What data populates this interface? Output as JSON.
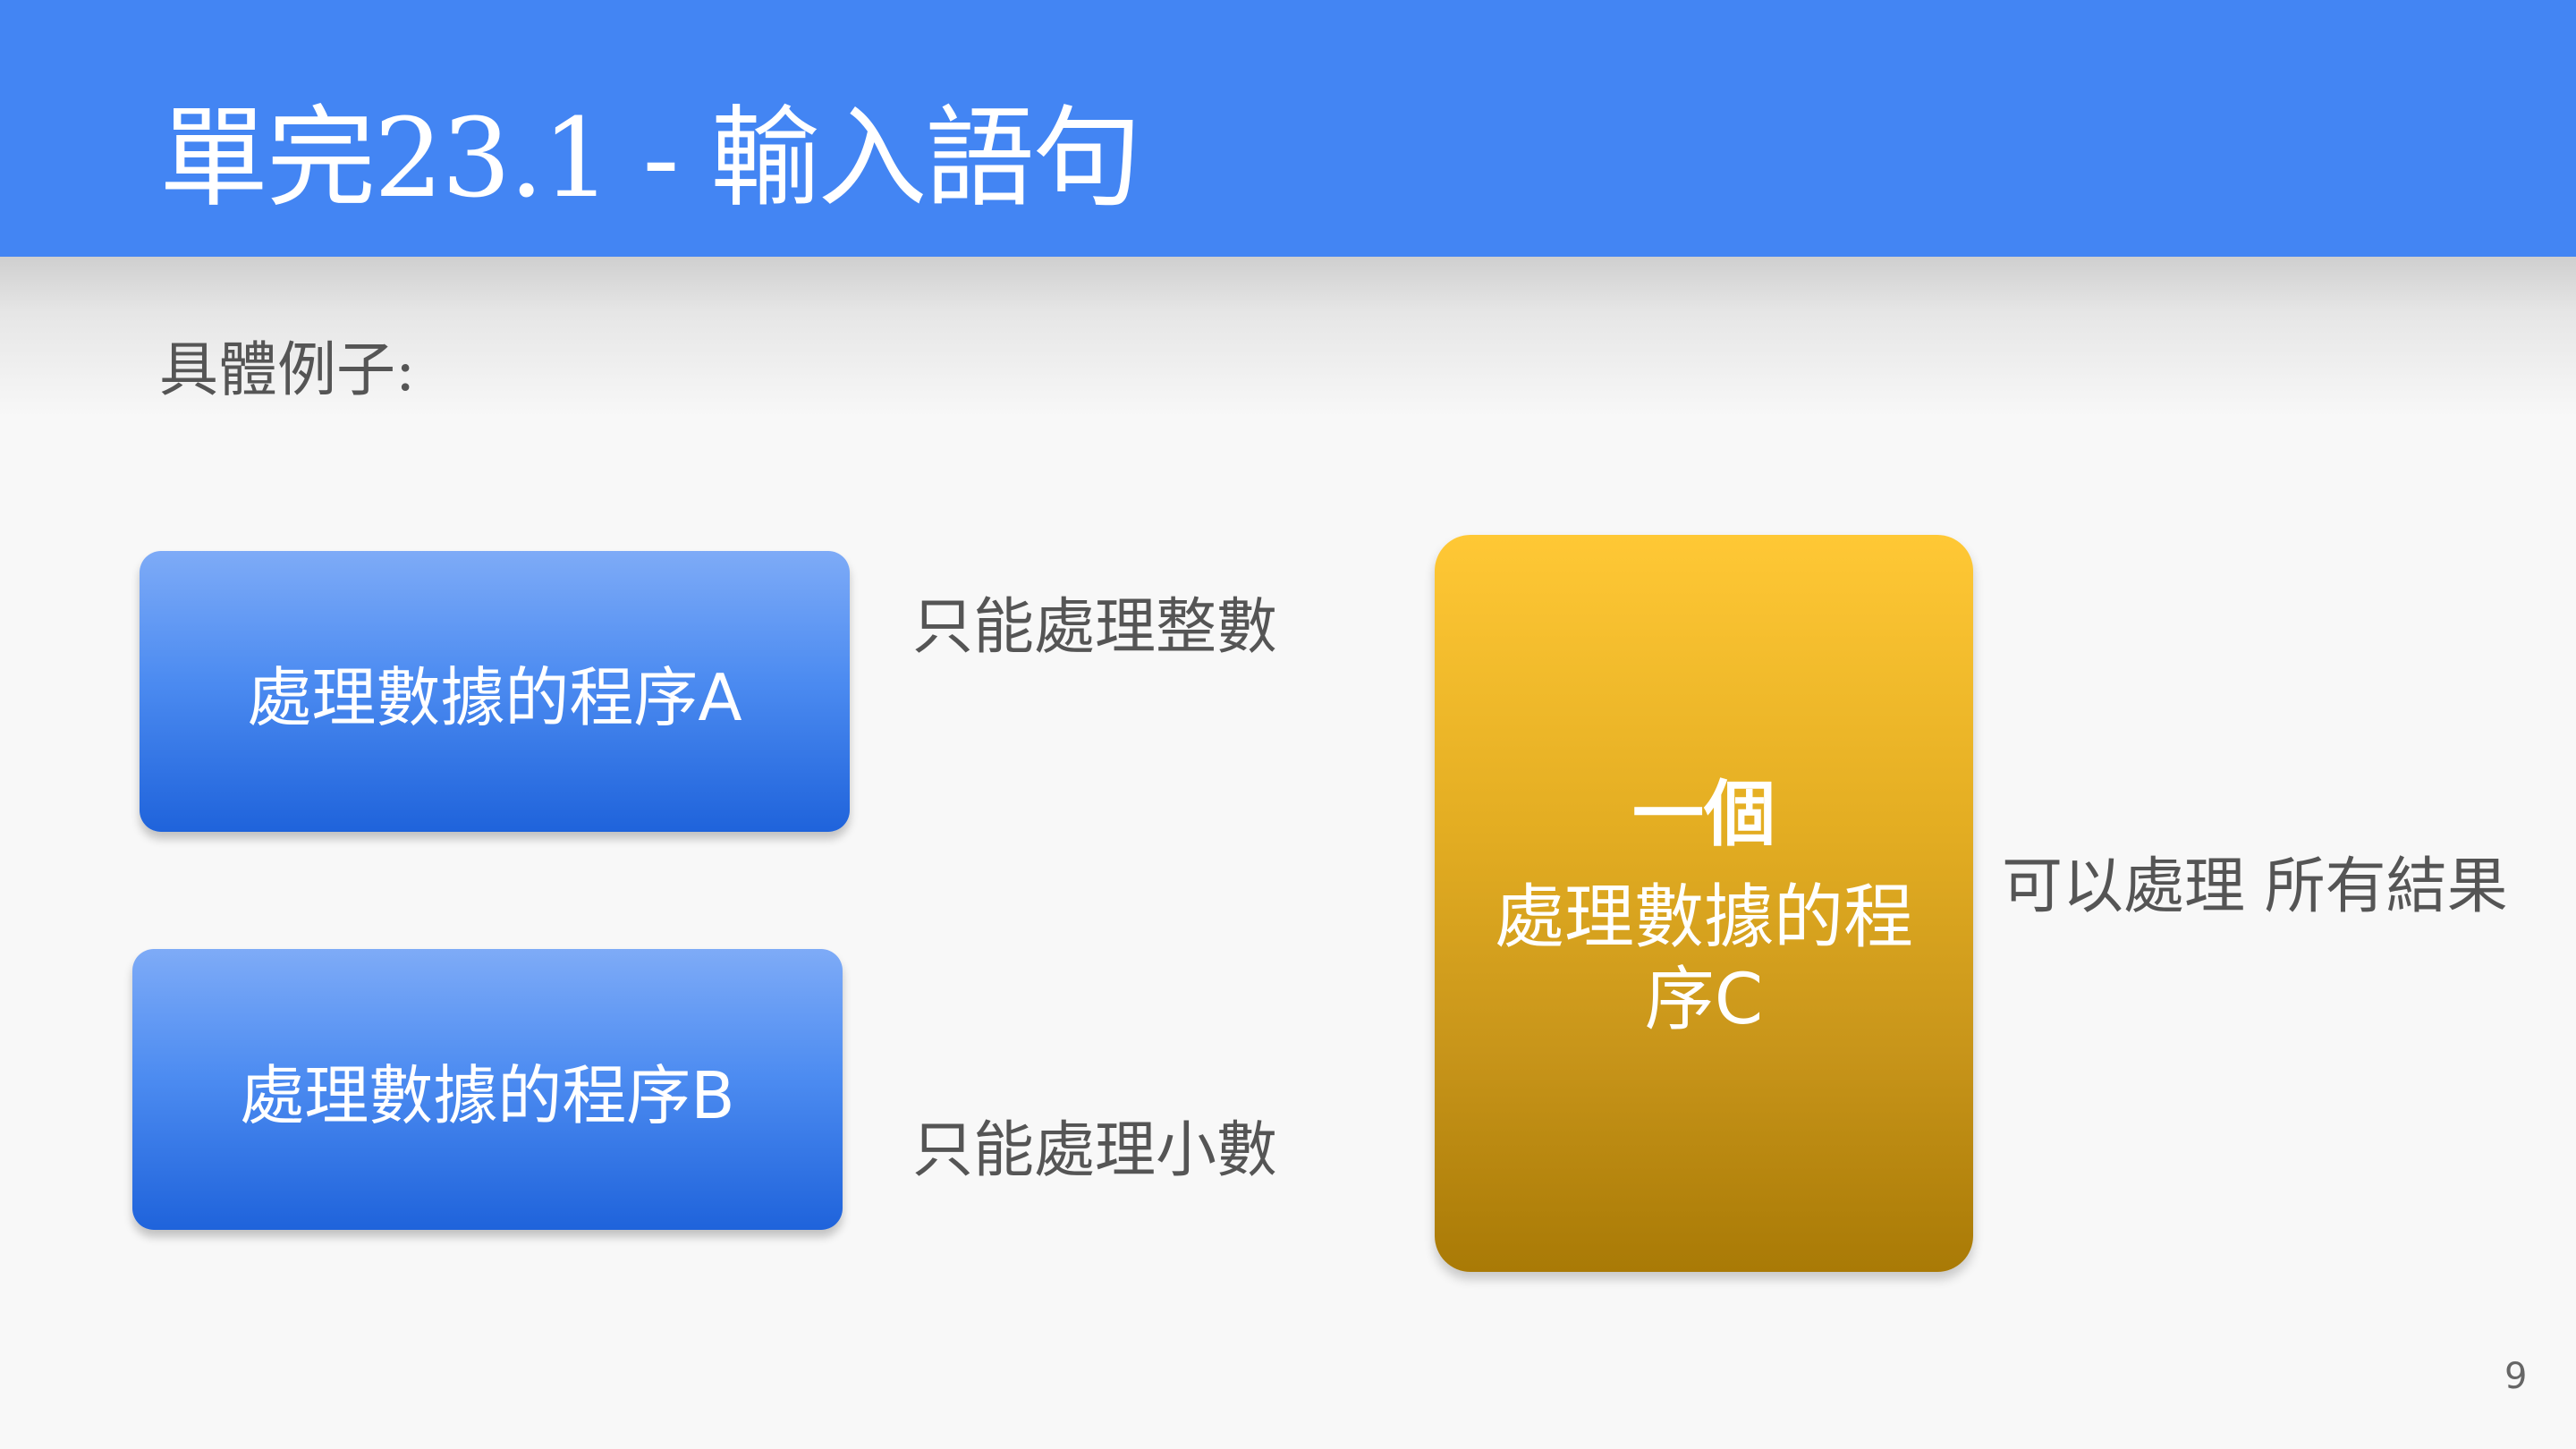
{
  "slide": {
    "title": "單完23.1 - 輸入語句",
    "subtitle": "具體例子:",
    "box_a": "處理數據的程序A",
    "box_b": "處理數據的程序B",
    "box_c": {
      "line1": "一個",
      "line2": "處理數據的程序C"
    },
    "note_a": "只能處理整數",
    "note_b": "只能處理小數",
    "note_c": "可以處理 所有結果",
    "page_number": "9"
  },
  "colors": {
    "title_bar": "#4385f3",
    "blue_box": "#4d8cf1",
    "gold_box": "#e3ad22",
    "text": "#555555"
  }
}
